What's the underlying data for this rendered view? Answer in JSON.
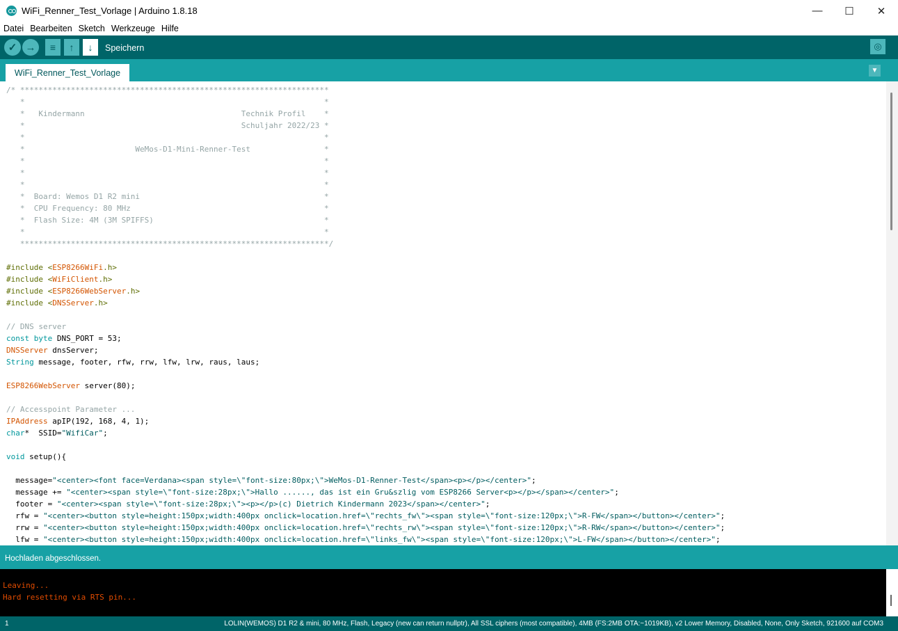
{
  "window": {
    "title": "WiFi_Renner_Test_Vorlage | Arduino 1.8.18"
  },
  "menu": [
    "Datei",
    "Bearbeiten",
    "Sketch",
    "Werkzeuge",
    "Hilfe"
  ],
  "toolbar": {
    "hover_label": "Speichern"
  },
  "tab": {
    "name": "WiFi_Renner_Test_Vorlage"
  },
  "code_lines": [
    [
      {
        "t": "/* *******************************************************************",
        "c": "com"
      }
    ],
    [
      {
        "t": "   *                                                                 *",
        "c": "com"
      }
    ],
    [
      {
        "t": "   *   Kindermann                                  Technik Profil    *",
        "c": "com"
      }
    ],
    [
      {
        "t": "   *                                               Schuljahr 2022/23 *",
        "c": "com"
      }
    ],
    [
      {
        "t": "   *                                                                 *",
        "c": "com"
      }
    ],
    [
      {
        "t": "   *                        WeMos-D1-Mini-Renner-Test                *",
        "c": "com"
      }
    ],
    [
      {
        "t": "   *                                                                 *",
        "c": "com"
      }
    ],
    [
      {
        "t": "   *                                                                 *",
        "c": "com"
      }
    ],
    [
      {
        "t": "   *                                                                 *",
        "c": "com"
      }
    ],
    [
      {
        "t": "   *  Board: Wemos D1 R2 mini                                        *",
        "c": "com"
      }
    ],
    [
      {
        "t": "   *  CPU Frequency: 80 MHz                                          *",
        "c": "com"
      }
    ],
    [
      {
        "t": "   *  Flash Size: 4M (3M SPIFFS)                                     *",
        "c": "com"
      }
    ],
    [
      {
        "t": "   *                                                                 *",
        "c": "com"
      }
    ],
    [
      {
        "t": "   *******************************************************************/",
        "c": "com"
      }
    ],
    [
      {
        "t": "",
        "c": ""
      }
    ],
    [
      {
        "t": "#include <",
        "c": "pre"
      },
      {
        "t": "ESP8266WiFi",
        "c": "type"
      },
      {
        "t": ".h>",
        "c": "pre"
      }
    ],
    [
      {
        "t": "#include <",
        "c": "pre"
      },
      {
        "t": "WiFiClient",
        "c": "type"
      },
      {
        "t": ".h>",
        "c": "pre"
      }
    ],
    [
      {
        "t": "#include <",
        "c": "pre"
      },
      {
        "t": "ESP8266WebServer",
        "c": "type"
      },
      {
        "t": ".h>",
        "c": "pre"
      }
    ],
    [
      {
        "t": "#include <",
        "c": "pre"
      },
      {
        "t": "DNSServer",
        "c": "type"
      },
      {
        "t": ".h>",
        "c": "pre"
      }
    ],
    [
      {
        "t": "",
        "c": ""
      }
    ],
    [
      {
        "t": "// DNS server",
        "c": "com"
      }
    ],
    [
      {
        "t": "const",
        "c": "kw"
      },
      {
        "t": " ",
        "c": ""
      },
      {
        "t": "byte",
        "c": "kw"
      },
      {
        "t": " DNS_PORT = 53;",
        "c": ""
      }
    ],
    [
      {
        "t": "DNSServer",
        "c": "type"
      },
      {
        "t": " dnsServer;",
        "c": ""
      }
    ],
    [
      {
        "t": "String",
        "c": "kw"
      },
      {
        "t": " message, footer, rfw, rrw, lfw, lrw, raus, laus;",
        "c": ""
      }
    ],
    [
      {
        "t": "",
        "c": ""
      }
    ],
    [
      {
        "t": "ESP8266WebServer",
        "c": "type"
      },
      {
        "t": " server(80);",
        "c": ""
      }
    ],
    [
      {
        "t": "",
        "c": ""
      }
    ],
    [
      {
        "t": "// Accesspoint Parameter ...",
        "c": "com"
      }
    ],
    [
      {
        "t": "IPAddress",
        "c": "type"
      },
      {
        "t": " apIP(192, 168, 4, 1);",
        "c": ""
      }
    ],
    [
      {
        "t": "char",
        "c": "kw"
      },
      {
        "t": "*  SSID=",
        "c": ""
      },
      {
        "t": "\"WifiCar\"",
        "c": "str"
      },
      {
        "t": ";",
        "c": ""
      }
    ],
    [
      {
        "t": "",
        "c": ""
      }
    ],
    [
      {
        "t": "void",
        "c": "kw"
      },
      {
        "t": " setup(){",
        "c": ""
      }
    ],
    [
      {
        "t": "",
        "c": ""
      }
    ],
    [
      {
        "t": "  message=",
        "c": ""
      },
      {
        "t": "\"<center><font face=Verdana><span style=\\\"font-size:80px;\\\">WeMos-D1-Renner-Test</span><p></p></center>\"",
        "c": "str"
      },
      {
        "t": ";",
        "c": ""
      }
    ],
    [
      {
        "t": "  message += ",
        "c": ""
      },
      {
        "t": "\"<center><span style=\\\"font-size:28px;\\\">Hallo ......, das ist ein Gru&szlig vom ESP8266 Server<p></p></span></center>\"",
        "c": "str"
      },
      {
        "t": ";",
        "c": ""
      }
    ],
    [
      {
        "t": "  footer = ",
        "c": ""
      },
      {
        "t": "\"<center><span style=\\\"font-size:28px;\\\"><p></p>(c) Dietrich Kindermann 2023</span></center>\"",
        "c": "str"
      },
      {
        "t": ";",
        "c": ""
      }
    ],
    [
      {
        "t": "  rfw = ",
        "c": ""
      },
      {
        "t": "\"<center><button style=height:150px;width:400px onclick=location.href=\\\"rechts_fw\\\"><span style=\\\"font-size:120px;\\\">R-FW</span></button></center>\"",
        "c": "str"
      },
      {
        "t": ";",
        "c": ""
      }
    ],
    [
      {
        "t": "  rrw = ",
        "c": ""
      },
      {
        "t": "\"<center><button style=height:150px;width:400px onclick=location.href=\\\"rechts_rw\\\"><span style=\\\"font-size:120px;\\\">R-RW</span></button></center>\"",
        "c": "str"
      },
      {
        "t": ";",
        "c": ""
      }
    ],
    [
      {
        "t": "  lfw = ",
        "c": ""
      },
      {
        "t": "\"<center><button style=height:150px;width:400px onclick=location.href=\\\"links_fw\\\"><span style=\\\"font-size:120px;\\\">L-FW</span></button></center>\"",
        "c": "str"
      },
      {
        "t": ";",
        "c": ""
      }
    ]
  ],
  "status": {
    "message": "Hochladen abgeschlossen."
  },
  "console": {
    "lines": [
      "Leaving...",
      "Hard resetting via RTS pin..."
    ]
  },
  "footer": {
    "line_number": "1",
    "board_info": "LOLIN(WEMOS) D1 R2 & mini, 80 MHz, Flash, Legacy (new can return nullptr), All SSL ciphers (most compatible), 4MB (FS:2MB OTA:~1019KB), v2 Lower Memory, Disabled, None, Only Sketch, 921600 auf COM3"
  }
}
